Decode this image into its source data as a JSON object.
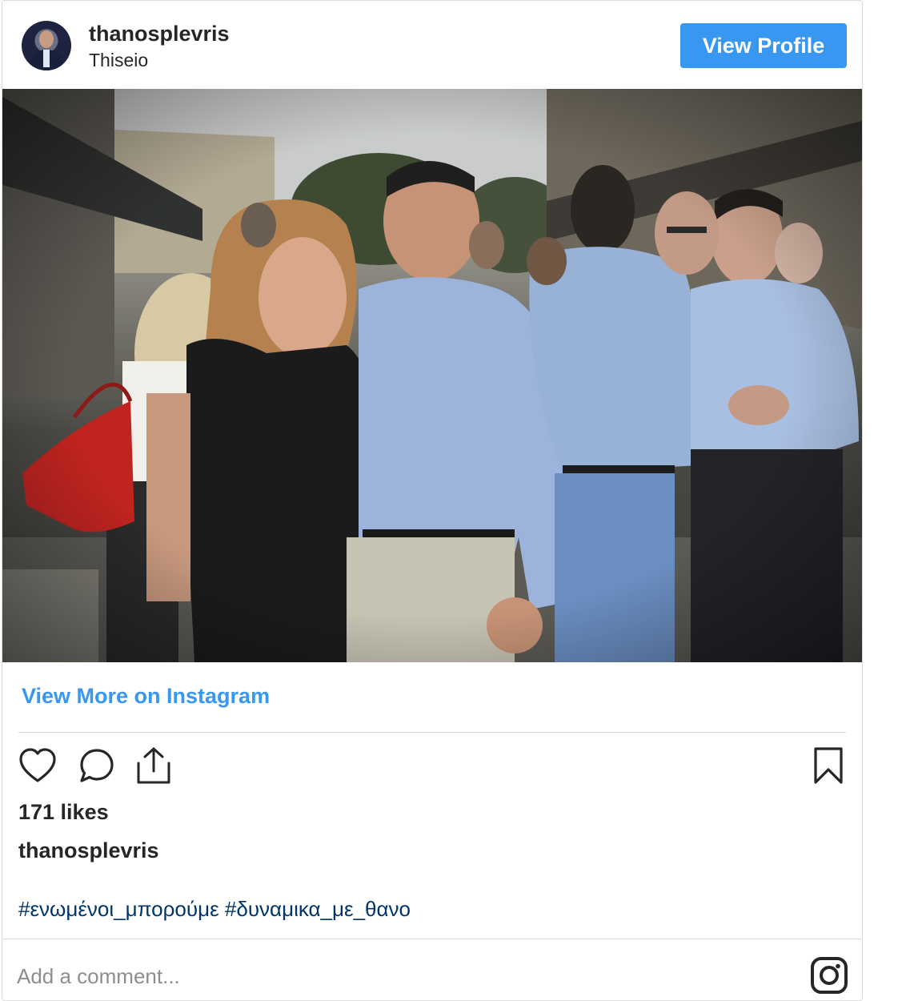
{
  "post": {
    "username": "thanosplevris",
    "location": "Thiseio",
    "view_profile_label": "View Profile",
    "view_more_label": "View More on Instagram",
    "likes": "171 likes",
    "caption_user": "thanosplevris",
    "hashtags": [
      "#ενωμένοι_μπορούμε",
      "#δυναμικα_με_θανο"
    ],
    "comment_placeholder": "Add a comment..."
  },
  "colors": {
    "accent": "#3897f0",
    "hashtag": "#003569",
    "border": "#dbdbdb",
    "text": "#262626",
    "placeholder": "#8e8e8e"
  },
  "icons": [
    "heart-icon",
    "comment-icon",
    "share-icon",
    "bookmark-icon",
    "instagram-logo-icon"
  ]
}
